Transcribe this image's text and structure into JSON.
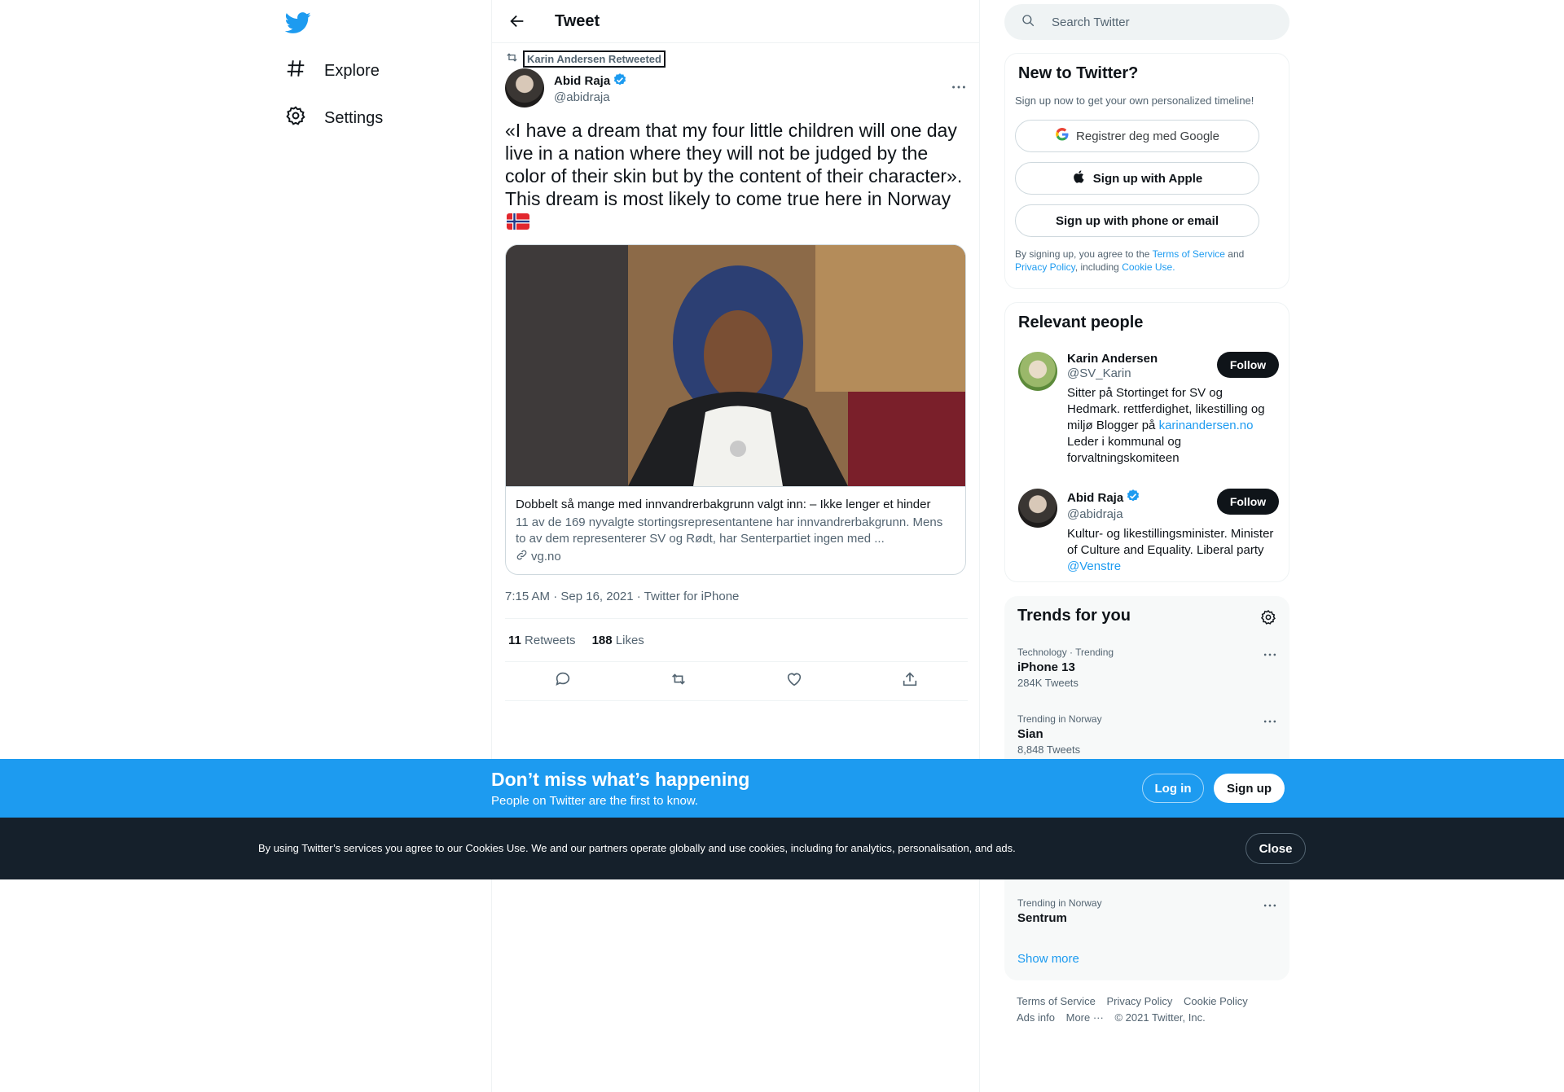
{
  "sidebar": {
    "logo": "twitter-bird-icon",
    "items": [
      {
        "label": "Explore",
        "icon": "hashtag-icon"
      },
      {
        "label": "Settings",
        "icon": "gear-icon"
      }
    ]
  },
  "main": {
    "header_title": "Tweet",
    "tweet": {
      "retweet_label": "Karin Andersen Retweeted",
      "author_name": "Abid Raja",
      "author_handle": "@abidraja",
      "text": "«I have a dream that my four little children will one day live in a nation where they will not be judged by the color of their skin but by the content of their character». This dream is most likely to come true here in Norway",
      "card": {
        "title": "Dobbelt så mange med innvandrerbakgrunn valgt inn: – Ikke lenger et hinder",
        "description": "11 av de 169 nyvalgte stortingsrepresentantene har innvandrerbakgrunn. Mens to av dem representerer SV og Rødt, har Senterpartiet ingen med ...",
        "domain": "vg.no"
      },
      "timestamp": "7:15 AM · Sep 16, 2021 · Twitter for iPhone",
      "retweets_count": "11",
      "retweets_label": "Retweets",
      "likes_count": "188",
      "likes_label": "Likes"
    }
  },
  "right": {
    "search_placeholder": "Search Twitter",
    "signup": {
      "title": "New to Twitter?",
      "subtitle": "Sign up now to get your own personalized timeline!",
      "google_label": "Registrer deg med Google",
      "apple_label": "Sign up with Apple",
      "phone_label": "Sign up with phone or email",
      "legal_prefix": "By signing up, you agree to the",
      "legal_terms": "Terms of Service",
      "legal_and": "and",
      "legal_privacy": "Privacy Policy",
      "legal_including": ", including",
      "legal_cookie": "Cookie Use."
    },
    "people": {
      "title": "Relevant people",
      "items": [
        {
          "name": "Karin Andersen",
          "handle": "@SV_Karin",
          "bio_prefix": "Sitter på Stortinget for SV og Hedmark. rettferdighet, likestilling og miljø Blogger på",
          "bio_link": "karinandersen.no",
          "bio_suffix": "Leder i kommunal og forvaltningskomiteen",
          "follow_label": "Follow"
        },
        {
          "name": "Abid Raja",
          "handle": "@abidraja",
          "bio_prefix": "Kultur- og likestillingsminister. Minister of Culture and Equality. Liberal party",
          "bio_link": "@Venstre",
          "follow_label": "Follow"
        }
      ]
    },
    "trends": {
      "title": "Trends for you",
      "items": [
        {
          "meta": "Technology · Trending",
          "name": "iPhone 13",
          "count": "284K Tweets"
        },
        {
          "meta": "Trending in Norway",
          "name": "Sian",
          "count": "8,848 Tweets"
        },
        {
          "meta": "Trending in Norway",
          "name": "Sentrum",
          "count": ""
        }
      ],
      "show_more": "Show more"
    },
    "footer": {
      "terms": "Terms of Service",
      "privacy": "Privacy Policy",
      "cookie": "Cookie Policy",
      "ads": "Ads info",
      "more": "More ···",
      "copyright": "© 2021 Twitter, Inc."
    }
  },
  "signup_bar": {
    "title": "Don’t miss what’s happening",
    "subtitle": "People on Twitter are the first to know.",
    "login_label": "Log in",
    "signup_label": "Sign up"
  },
  "cookie_bar": {
    "text": "By using Twitter’s services you agree to our Cookies Use. We and our partners operate globally and use cookies, including for analytics, personalisation, and ads.",
    "close_label": "Close"
  },
  "colors": {
    "brand": "#1d9bf0",
    "text": "#0f1419",
    "secondary": "#536471",
    "cookie_bg": "#15202b"
  }
}
